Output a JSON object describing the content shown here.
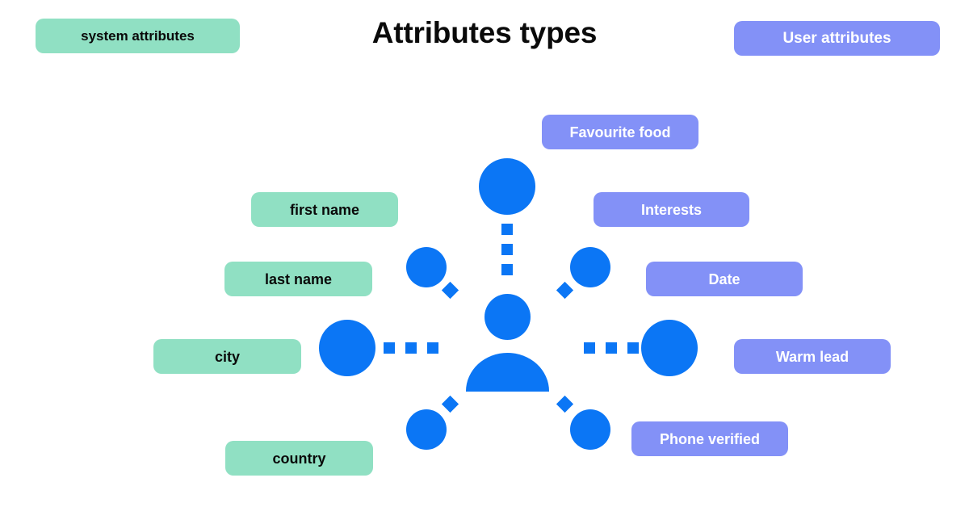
{
  "header": {
    "title": "Attributes types",
    "legend_left": {
      "label": "system attributes",
      "color": "#90E0C3",
      "text_color": "#0a0a0a"
    },
    "legend_right": {
      "label": "User attributes",
      "color": "#8391F7",
      "text_color": "#ffffff"
    }
  },
  "diagram": {
    "center_icon": "user-person-icon",
    "center_icon_color": "#0B76F5",
    "connector_shape_horizontal": "square-dot",
    "connector_shape_vertical": "square-dot",
    "connector_shape_diagonal": "diamond-dot",
    "system_attributes": [
      {
        "label": "first name"
      },
      {
        "label": "last name"
      },
      {
        "label": "city"
      },
      {
        "label": "country"
      }
    ],
    "user_attributes": [
      {
        "label": "Favourite food"
      },
      {
        "label": "Interests"
      },
      {
        "label": "Date"
      },
      {
        "label": "Warm lead"
      },
      {
        "label": "Phone verified"
      }
    ]
  },
  "colors": {
    "blue": "#0B76F5",
    "mint": "#90E0C3",
    "periwinkle": "#8391F7",
    "background": "#ffffff",
    "title": "#0a0a0a"
  }
}
